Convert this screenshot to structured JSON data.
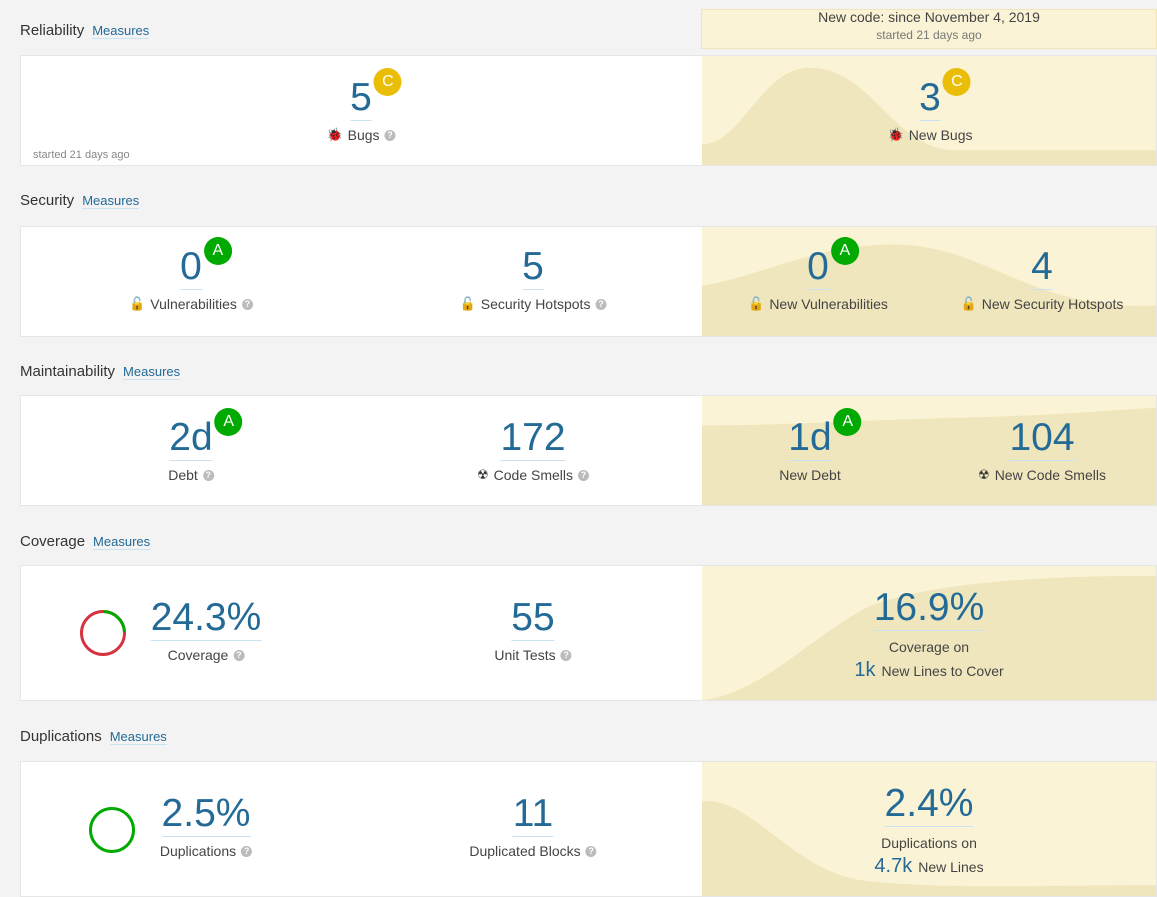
{
  "leak_period": {
    "title": "New code: since November 4, 2019",
    "started": "started 21 days ago"
  },
  "reliability": {
    "title": "Reliability",
    "measures": "Measures",
    "started": "started 21 days ago",
    "bugs": {
      "value": "5",
      "rating": "C",
      "label": "Bugs"
    },
    "new_bugs": {
      "value": "3",
      "rating": "C",
      "label": "New Bugs"
    }
  },
  "security": {
    "title": "Security",
    "measures": "Measures",
    "vulnerabilities": {
      "value": "0",
      "rating": "A",
      "label": "Vulnerabilities"
    },
    "hotspots": {
      "value": "5",
      "label": "Security Hotspots"
    },
    "new_vulnerabilities": {
      "value": "0",
      "rating": "A",
      "label": "New Vulnerabilities"
    },
    "new_hotspots": {
      "value": "4",
      "label": "New Security Hotspots"
    }
  },
  "maintainability": {
    "title": "Maintainability",
    "measures": "Measures",
    "debt": {
      "value": "2d",
      "rating": "A",
      "label": "Debt"
    },
    "code_smells": {
      "value": "172",
      "label": "Code Smells"
    },
    "new_debt": {
      "value": "1d",
      "rating": "A",
      "label": "New Debt"
    },
    "new_code_smells": {
      "value": "104",
      "label": "New Code Smells"
    }
  },
  "coverage": {
    "title": "Coverage",
    "measures": "Measures",
    "coverage": {
      "value": "24.3%",
      "label": "Coverage",
      "fraction": 0.243
    },
    "unit_tests": {
      "value": "55",
      "label": "Unit Tests"
    },
    "new_coverage": {
      "value": "16.9%",
      "label": "Coverage on",
      "lines_value": "1k",
      "lines_label": "New Lines to Cover"
    }
  },
  "duplications": {
    "title": "Duplications",
    "measures": "Measures",
    "duplications": {
      "value": "2.5%",
      "label": "Duplications"
    },
    "blocks": {
      "value": "11",
      "label": "Duplicated Blocks"
    },
    "new_duplications": {
      "value": "2.4%",
      "label": "Duplications on",
      "lines_value": "4.7k",
      "lines_label": "New Lines"
    }
  },
  "colors": {
    "link": "#236a97",
    "rating_a": "#00aa00",
    "rating_c": "#eabe06",
    "leak_bg": "#fbf3d5",
    "coverage_red": "#d4333f",
    "coverage_green": "#00aa00"
  },
  "help_icon": "?"
}
